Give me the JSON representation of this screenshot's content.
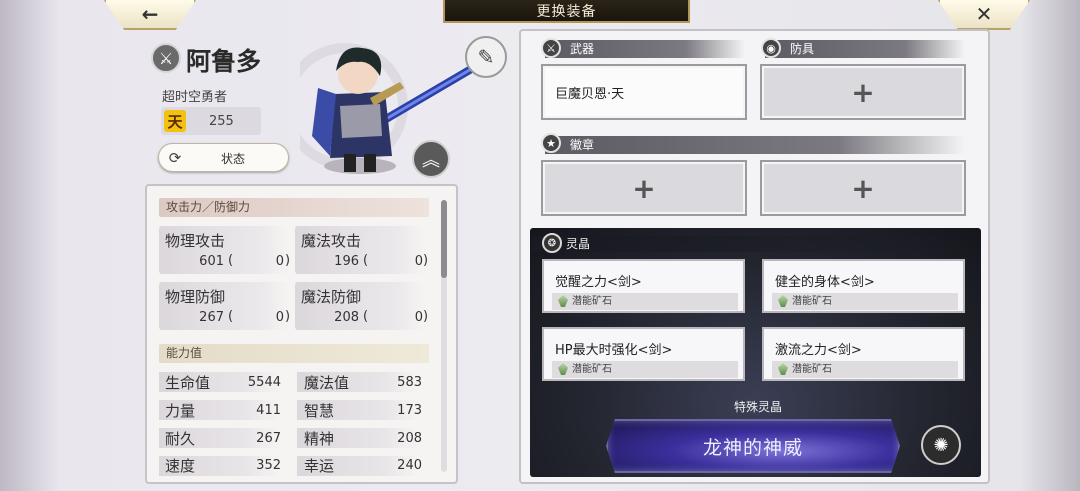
{
  "header": {
    "title": "更换装备",
    "back_icon": "←",
    "close_icon": "✕"
  },
  "character": {
    "name": "阿鲁多",
    "title": "超时空勇者",
    "rank_glyph": "天",
    "rank_value": "255",
    "status_label": "状态",
    "status_icon": "⟳",
    "note_icon": "✎",
    "up_icon": "︽",
    "class_icon": "⚔"
  },
  "stats": {
    "attack_defense_header": "攻击力／防御力",
    "attack_defense": [
      {
        "label": "物理攻击",
        "value": "601",
        "bonus": "0"
      },
      {
        "label": "魔法攻击",
        "value": "196",
        "bonus": "0"
      },
      {
        "label": "物理防御",
        "value": "267",
        "bonus": "0"
      },
      {
        "label": "魔法防御",
        "value": "208",
        "bonus": "0"
      }
    ],
    "ability_header": "能力值",
    "abilities": [
      {
        "label": "生命值",
        "value": "5544"
      },
      {
        "label": "魔法值",
        "value": "583"
      },
      {
        "label": "力量",
        "value": "411"
      },
      {
        "label": "智慧",
        "value": "173"
      },
      {
        "label": "耐久",
        "value": "267"
      },
      {
        "label": "精神",
        "value": "208"
      },
      {
        "label": "速度",
        "value": "352"
      },
      {
        "label": "幸运",
        "value": "240"
      }
    ]
  },
  "equipment": {
    "weapon_label": "武器",
    "armor_label": "防具",
    "badge_label": "徽章",
    "weapon_item": "巨魔贝恩·天",
    "plus": "+",
    "weapon_icon": "⚔",
    "armor_icon": "◉",
    "badge_icon": "★"
  },
  "crystals": {
    "label": "灵晶",
    "icon": "❂",
    "items": [
      {
        "name": "觉醒之力<剑>",
        "tag": "潜能矿石"
      },
      {
        "name": "健全的身体<剑>",
        "tag": "潜能矿石"
      },
      {
        "name": "HP最大时强化<剑>",
        "tag": "潜能矿石"
      },
      {
        "name": "激流之力<剑>",
        "tag": "潜能矿石"
      }
    ],
    "special_label": "特殊灵晶",
    "special_name": "龙神的神威",
    "special_icon": "✺"
  }
}
